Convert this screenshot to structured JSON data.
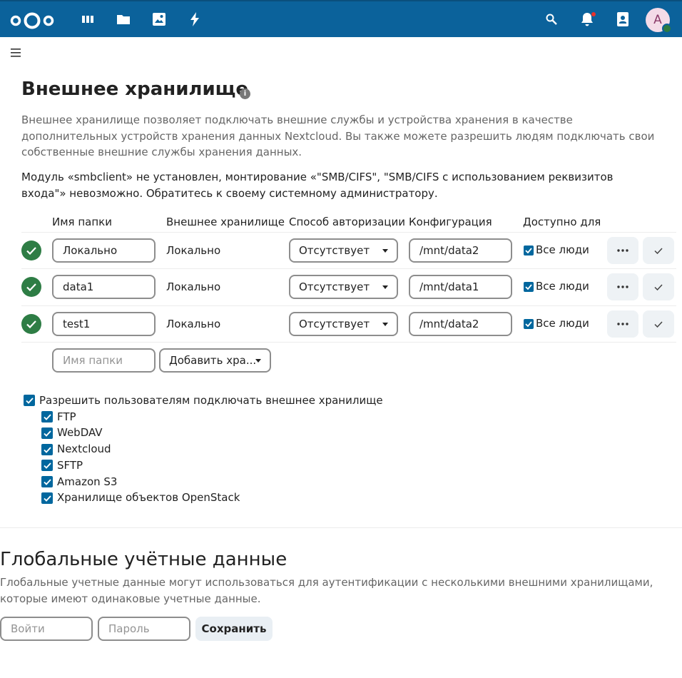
{
  "header": {
    "nav": [
      {
        "name": "dashboard-icon"
      },
      {
        "name": "files-icon"
      },
      {
        "name": "photos-icon"
      },
      {
        "name": "activity-icon"
      }
    ],
    "right": [
      {
        "name": "search-icon"
      },
      {
        "name": "notifications-icon"
      },
      {
        "name": "contacts-icon"
      }
    ],
    "avatar_letter": "A"
  },
  "page": {
    "title": "Внешнее хранилище",
    "info_icon": "i",
    "description": "Внешнее хранилище позволяет подключать внешние службы и устройства хранения в качестве дополнительных устройств хранения данных Nextcloud. Вы также можете разрешить людям подключать свои собственные внешние службы хранения данных.",
    "warning": "Модуль «smbclient» не установлен, монтирование «\"SMB/CIFS\", \"SMB/CIFS с использованием реквизитов входа\"» невозможно. Обратитесь к своему системному администратору."
  },
  "table": {
    "headers": {
      "folder": "Имя папки",
      "storage": "Внешнее хранилище",
      "auth": "Способ авторизации",
      "config": "Конфигурация",
      "available": "Доступно для"
    },
    "rows": [
      {
        "folder": "Локально",
        "storage": "Локально",
        "auth": "Отсутствует",
        "config": "/mnt/data2",
        "available": "Все люди"
      },
      {
        "folder": "data1",
        "storage": "Локально",
        "auth": "Отсутствует",
        "config": "/mnt/data1",
        "available": "Все люди"
      },
      {
        "folder": "test1",
        "storage": "Локально",
        "auth": "Отсутствует",
        "config": "/mnt/data2",
        "available": "Все люди"
      }
    ],
    "new_row": {
      "folder_placeholder": "Имя папки",
      "add_storage": "Добавить хра..."
    }
  },
  "allow_users": {
    "label": "Разрешить пользователям подключать внешнее хранилище",
    "backends": [
      "FTP",
      "WebDAV",
      "Nextcloud",
      "SFTP",
      "Amazon S3",
      "Хранилище объектов OpenStack"
    ]
  },
  "global_credentials": {
    "title": "Глобальные учётные данные",
    "description": "Глобальные учетные данные могут использоваться для аутентификации с несколькими внешними хранилищами, которые имеют одинаковые учетные данные.",
    "login_placeholder": "Войти",
    "password_placeholder": "Пароль",
    "save_label": "Сохранить"
  },
  "colors": {
    "header": "#0b629b",
    "accent": "#00679e",
    "success": "#2e7d45"
  }
}
